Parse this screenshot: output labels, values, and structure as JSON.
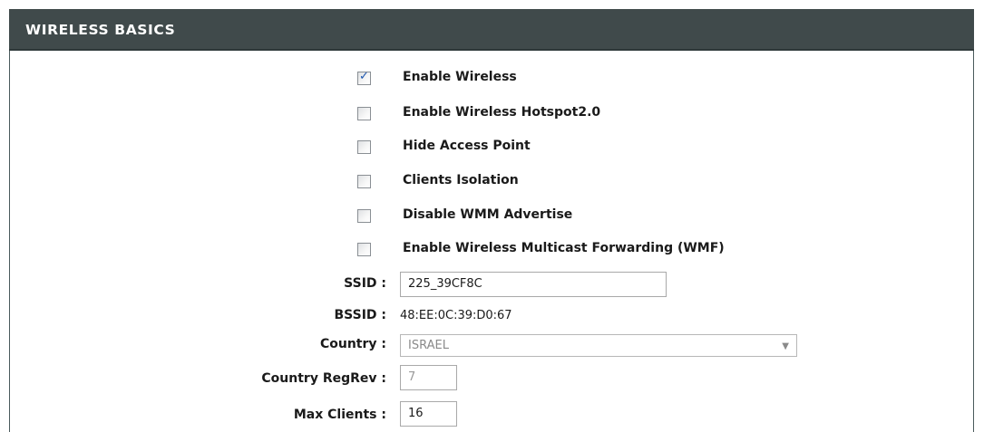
{
  "section": {
    "title": "WIRELESS BASICS"
  },
  "options": [
    {
      "label": "Enable Wireless",
      "checked": true
    },
    {
      "label": "Enable Wireless Hotspot2.0",
      "checked": false
    },
    {
      "label": "Hide Access Point",
      "checked": false
    },
    {
      "label": "Clients Isolation",
      "checked": false
    },
    {
      "label": "Disable WMM Advertise",
      "checked": false
    },
    {
      "label": "Enable Wireless Multicast Forwarding (WMF)",
      "checked": false
    }
  ],
  "fields": {
    "ssid": {
      "label": "SSID :",
      "value": "225_39CF8C"
    },
    "bssid": {
      "label": "BSSID :",
      "value": "48:EE:0C:39:D0:67"
    },
    "country": {
      "label": "Country :",
      "value": "ISRAEL"
    },
    "country_regrev": {
      "label": "Country RegRev :",
      "value": "7"
    },
    "max_clients": {
      "label": "Max Clients :",
      "value": "16"
    }
  },
  "icons": {
    "checkmark": "checkmark-icon",
    "dropdown_arrow": "chevron-down-icon"
  },
  "colors": {
    "header_bg": "#404a4b",
    "header_text": "#ffffff",
    "check_color": "#1e57b0"
  }
}
